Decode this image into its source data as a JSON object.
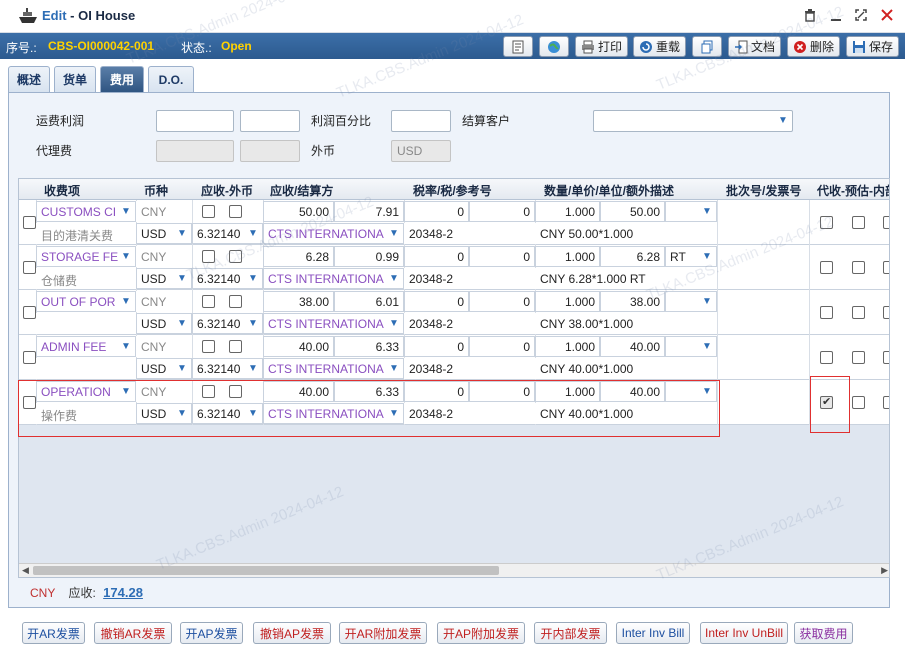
{
  "window": {
    "mode": "Edit",
    "sep": " - ",
    "title": "OI House"
  },
  "info": {
    "seq_label": "序号.:",
    "seq_value": "CBS-OI000042-001",
    "status_label": "状态.:",
    "status_value": "Open"
  },
  "toolbar": {
    "print": "打印",
    "reload": "重载",
    "doc": "文档",
    "delete": "删除",
    "save": "保存"
  },
  "tabs": [
    "概述",
    "货单",
    "费用",
    "D.O."
  ],
  "form": {
    "freight_profit": "运费利润",
    "profit_percent": "利润百分比",
    "settle_customer": "结算客户",
    "agent_fee": "代理费",
    "foreign_currency": "外币",
    "currency_value": "USD"
  },
  "grid": {
    "headers": [
      "收费项",
      "币种",
      "应收-外币",
      "应收/结算方",
      "税率/税/参考号",
      "数量/单价/单位/额外描述",
      "批次号/发票号",
      "代收-预估-内部"
    ],
    "rows": [
      {
        "item": "CUSTOMS CI",
        "desc": "目的港清关费",
        "cur1": "CNY",
        "cur2": "USD",
        "rate": "6.32140",
        "amount": "50.00",
        "amount2": "7.91",
        "party": "CTS INTERNATIONA",
        "tax1": "0",
        "tax2": "0",
        "ref": "20348-2",
        "qty": "1.000",
        "price": "50.00",
        "unit": "",
        "extra": "CNY 50.00*1.000",
        "collect": false
      },
      {
        "item": "STORAGE FE",
        "desc": "仓储费",
        "cur1": "CNY",
        "cur2": "USD",
        "rate": "6.32140",
        "amount": "6.28",
        "amount2": "0.99",
        "party": "CTS INTERNATIONA",
        "tax1": "0",
        "tax2": "0",
        "ref": "20348-2",
        "qty": "1.000",
        "price": "6.28",
        "unit": "RT",
        "extra": "CNY 6.28*1.000 RT",
        "collect": false
      },
      {
        "item": "OUT OF POR",
        "desc": "",
        "cur1": "CNY",
        "cur2": "USD",
        "rate": "6.32140",
        "amount": "38.00",
        "amount2": "6.01",
        "party": "CTS INTERNATIONA",
        "tax1": "0",
        "tax2": "0",
        "ref": "20348-2",
        "qty": "1.000",
        "price": "38.00",
        "unit": "",
        "extra": "CNY 38.00*1.000",
        "collect": false
      },
      {
        "item": "ADMIN FEE",
        "desc": "",
        "cur1": "CNY",
        "cur2": "USD",
        "rate": "6.32140",
        "amount": "40.00",
        "amount2": "6.33",
        "party": "CTS INTERNATIONA",
        "tax1": "0",
        "tax2": "0",
        "ref": "20348-2",
        "qty": "1.000",
        "price": "40.00",
        "unit": "",
        "extra": "CNY 40.00*1.000",
        "collect": false
      },
      {
        "item": "OPERATION",
        "desc": "操作费",
        "cur1": "CNY",
        "cur2": "USD",
        "rate": "6.32140",
        "amount": "40.00",
        "amount2": "6.33",
        "party": "CTS INTERNATIONA",
        "tax1": "0",
        "tax2": "0",
        "ref": "20348-2",
        "qty": "1.000",
        "price": "40.00",
        "unit": "",
        "extra": "CNY 40.00*1.000",
        "collect": true
      }
    ]
  },
  "summary": {
    "currency": "CNY",
    "receivable_label": "应收:",
    "receivable_value": "174.28"
  },
  "bottom_buttons": [
    "开AR发票",
    "撤销AR发票",
    "开AP发票",
    "撤销AP发票",
    "开AR附加发票",
    "开AP附加发票",
    "开内部发票",
    "Inter Inv Bill",
    "Inter Inv UnBill",
    "获取费用"
  ],
  "watermark": "TLKA.CBS.Admin 2024-04-12"
}
